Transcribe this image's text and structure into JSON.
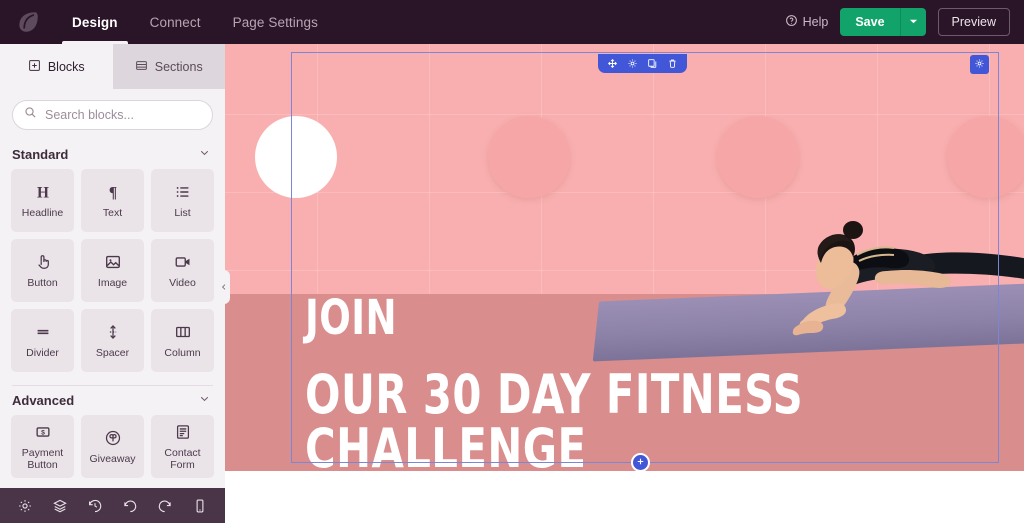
{
  "colors": {
    "topbar_bg": "#2a1427",
    "accent_save": "#12a36b",
    "selection_blue": "#4157d8",
    "sidebar_bg": "#f5f2f5",
    "tile_bg": "#eae4e9",
    "wall_pink": "#f9afaf",
    "floor_rose": "#d98d8d",
    "mat_purple": "#8d82a8"
  },
  "topbar": {
    "logo_icon": "leaf-logo-icon",
    "tabs": [
      {
        "label": "Design",
        "active": true
      },
      {
        "label": "Connect",
        "active": false
      },
      {
        "label": "Page Settings",
        "active": false
      }
    ],
    "help_label": "Help",
    "help_icon": "question-circle-icon",
    "save_label": "Save",
    "save_caret_icon": "caret-down-icon",
    "preview_label": "Preview"
  },
  "sidebar": {
    "tabs": [
      {
        "label": "Blocks",
        "icon": "blocks-icon",
        "active": true
      },
      {
        "label": "Sections",
        "icon": "sections-icon",
        "active": false
      }
    ],
    "search": {
      "placeholder": "Search blocks...",
      "value": "",
      "icon": "search-icon"
    },
    "groups": [
      {
        "title": "Standard",
        "collapse_icon": "chevron-down-icon",
        "items": [
          {
            "label": "Headline",
            "icon": "headline-icon"
          },
          {
            "label": "Text",
            "icon": "paragraph-icon"
          },
          {
            "label": "List",
            "icon": "list-icon"
          },
          {
            "label": "Button",
            "icon": "button-tap-icon"
          },
          {
            "label": "Image",
            "icon": "image-icon"
          },
          {
            "label": "Video",
            "icon": "video-icon"
          },
          {
            "label": "Divider",
            "icon": "divider-icon"
          },
          {
            "label": "Spacer",
            "icon": "spacer-icon"
          },
          {
            "label": "Column",
            "icon": "column-icon"
          }
        ]
      },
      {
        "title": "Advanced",
        "collapse_icon": "chevron-down-icon",
        "items": [
          {
            "label": "Payment Button",
            "icon": "payment-icon"
          },
          {
            "label": "Giveaway",
            "icon": "giveaway-icon"
          },
          {
            "label": "Contact Form",
            "icon": "contact-form-icon"
          }
        ]
      }
    ],
    "collapse_handle_icon": "chevron-left-icon",
    "bottom_tools": [
      {
        "name": "settings",
        "icon": "gear-icon"
      },
      {
        "name": "layers",
        "icon": "layers-icon"
      },
      {
        "name": "history",
        "icon": "history-icon"
      },
      {
        "name": "undo",
        "icon": "undo-icon"
      },
      {
        "name": "redo",
        "icon": "redo-icon"
      },
      {
        "name": "mobile-preview",
        "icon": "mobile-icon"
      }
    ]
  },
  "canvas": {
    "section_toolbar": [
      {
        "name": "move",
        "icon": "move-arrows-icon"
      },
      {
        "name": "settings",
        "icon": "gear-icon"
      },
      {
        "name": "duplicate",
        "icon": "copy-icon"
      },
      {
        "name": "delete",
        "icon": "trash-icon"
      }
    ],
    "row_settings_icon": "gear-icon",
    "add_section_icon": "plus-circle-icon",
    "hero": {
      "eyebrow": "JOIN",
      "headline": "OUR 30 DAY FITNESS CHALLENGE",
      "image_alt": "woman-plank-exercise-photo"
    }
  }
}
